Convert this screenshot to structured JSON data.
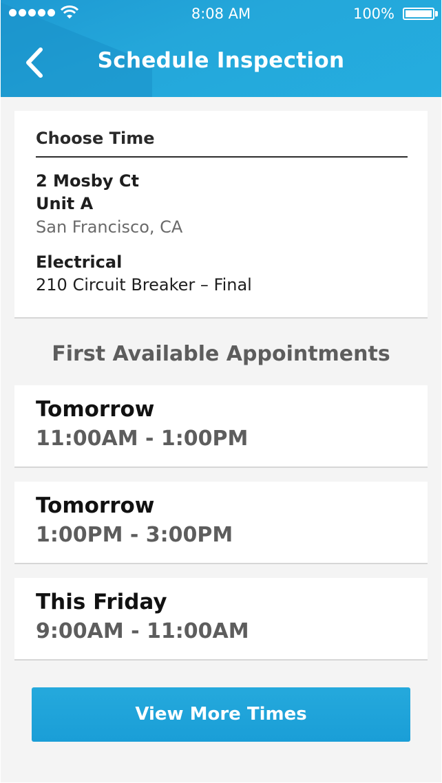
{
  "status_bar": {
    "time": "8:08 AM",
    "battery_percent": "100%",
    "signal_bars": 5,
    "signal_icon": "cellular-signal-dots",
    "wifi_icon": "wifi-icon",
    "battery_icon": "battery-full-icon",
    "battery_level": 1.0
  },
  "header": {
    "title": "Schedule Inspection",
    "back_icon": "chevron-left-icon",
    "background_color": "#25a7db"
  },
  "inspection": {
    "section_title": "Choose Time",
    "address_line1": "2 Mosby Ct",
    "address_line2": "Unit A",
    "city_state": "San Francisco, CA",
    "category": "Electrical",
    "item": "210 Circuit Breaker – Final"
  },
  "appointments": {
    "heading": "First Available Appointments",
    "slots": [
      {
        "day": "Tomorrow",
        "time": "11:00AM - 1:00PM"
      },
      {
        "day": "Tomorrow",
        "time": "1:00PM - 3:00PM"
      },
      {
        "day": "This Friday",
        "time": "9:00AM - 11:00AM"
      }
    ]
  },
  "actions": {
    "view_more_label": "View More Times",
    "accent_color": "#1fa4da"
  }
}
